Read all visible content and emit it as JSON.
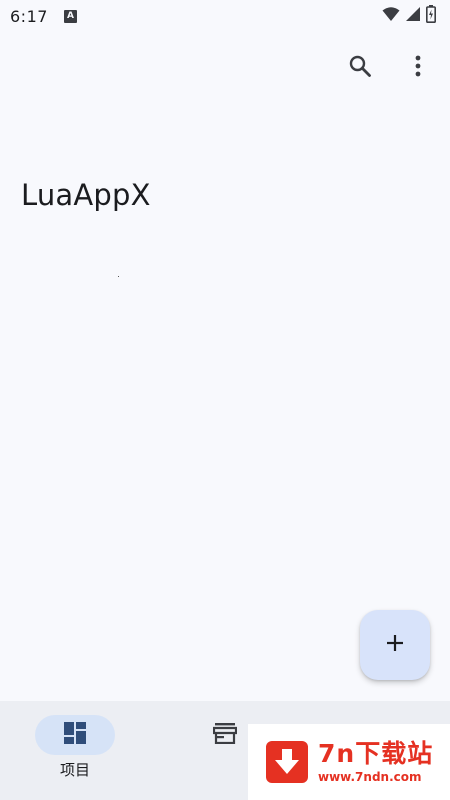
{
  "status_bar": {
    "time": "6:17",
    "notification_badge": "A",
    "icons": [
      "wifi-icon",
      "signal-icon",
      "battery-icon"
    ]
  },
  "app_bar": {
    "actions": [
      "search-icon",
      "more-vert-icon"
    ]
  },
  "main": {
    "title": "LuaAppX"
  },
  "fab": {
    "icon": "add-icon",
    "symbol": "+"
  },
  "bottom_nav": {
    "items": [
      {
        "label": "项目",
        "icon": "dashboard-icon",
        "selected": true
      },
      {
        "label": "",
        "icon": "store-icon",
        "selected": false
      }
    ]
  },
  "watermark": {
    "brand": "7n下载站",
    "url": "www.7ndn.com",
    "icon": "download-arrow-icon"
  },
  "colors": {
    "background": "#f8f9fd",
    "fab": "#d8e3fa",
    "nav_background": "#eceef3",
    "nav_active_pill": "#d6e3f7",
    "icon_primary": "#2f4d7a",
    "watermark_red": "#e53122"
  }
}
